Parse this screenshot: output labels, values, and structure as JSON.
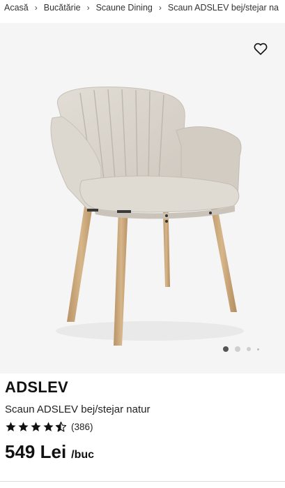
{
  "breadcrumb": {
    "items": [
      {
        "label": "Acasă"
      },
      {
        "label": "Bucătărie"
      },
      {
        "label": "Scaune Dining"
      },
      {
        "label": "Scaun ADSLEV bej/stejar na"
      }
    ],
    "separator": "›"
  },
  "gallery": {
    "image_alt": "Scaun ADSLEV bej/stejar natur",
    "wishlist_icon": "heart-outline-icon",
    "slide_count": 4,
    "active_slide": 1
  },
  "product": {
    "name": "ADSLEV",
    "description": "Scaun ADSLEV bej/stejar natur",
    "rating": 4.5,
    "rating_max": 5,
    "reviews": "(386)",
    "price": "549 Lei",
    "unit": "/buc"
  },
  "colors": {
    "text": "#111111",
    "gallery_bg": "#f5f5f5",
    "fabric": "#d9d4cc",
    "wood": "#c9a77c",
    "dot_active": "#555555",
    "dot_inactive": "#cfcfcf"
  }
}
